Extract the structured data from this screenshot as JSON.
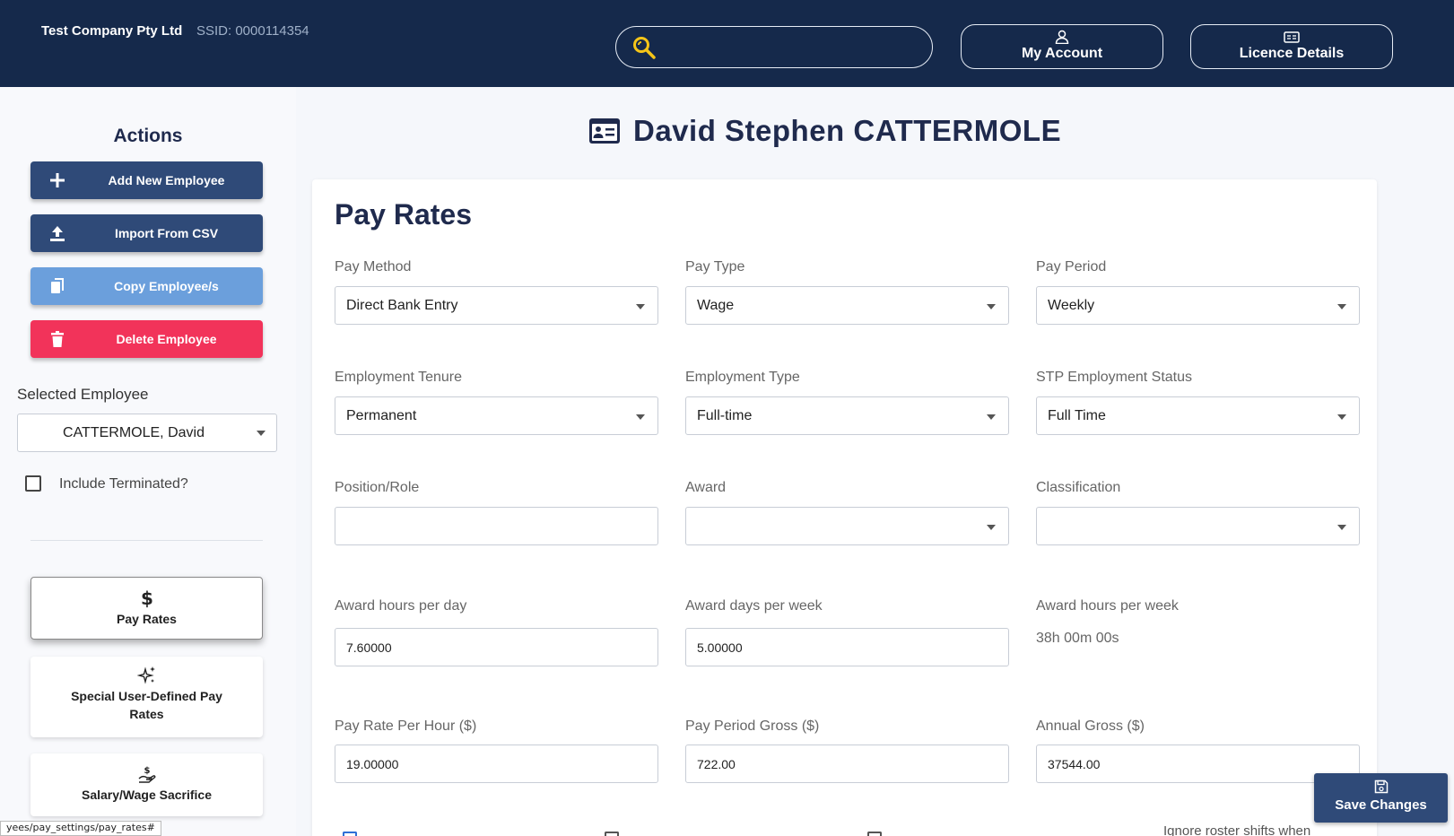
{
  "header": {
    "company": "Test Company Pty Ltd",
    "ssid": "SSID: 0000114354",
    "search": {
      "placeholder": ""
    },
    "my_account": "My Account",
    "licence_details": "Licence Details"
  },
  "sidebar": {
    "actions_title": "Actions",
    "buttons": {
      "add": "Add New Employee",
      "import": "Import From CSV",
      "copy": "Copy Employee/s",
      "delete": "Delete Employee"
    },
    "selected_employee_label": "Selected Employee",
    "selected_employee": "CATTERMOLE, David",
    "include_terminated": "Include Terminated?",
    "include_terminated_checked": false,
    "nav": {
      "pay_rates": "Pay Rates",
      "special": "Special User-Defined Pay Rates",
      "salary": "Salary/Wage Sacrifice"
    },
    "status_url": "yees/pay_settings/pay_rates#"
  },
  "main": {
    "employee_name": "David Stephen CATTERMOLE",
    "section_title": "Pay Rates",
    "fields": {
      "pay_method": {
        "label": "Pay Method",
        "value": "Direct Bank Entry"
      },
      "pay_type": {
        "label": "Pay Type",
        "value": "Wage"
      },
      "pay_period": {
        "label": "Pay Period",
        "value": "Weekly"
      },
      "employment_tenure": {
        "label": "Employment Tenure",
        "value": "Permanent"
      },
      "employment_type": {
        "label": "Employment Type",
        "value": "Full-time"
      },
      "stp_status": {
        "label": "STP Employment Status",
        "value": "Full Time"
      },
      "position_role": {
        "label": "Position/Role",
        "value": ""
      },
      "award": {
        "label": "Award",
        "value": ""
      },
      "classification": {
        "label": "Classification",
        "value": ""
      },
      "award_hours_day": {
        "label": "Award hours per day",
        "value": "7.60000"
      },
      "award_days_week": {
        "label": "Award days per week",
        "value": "5.00000"
      },
      "award_hours_week": {
        "label": "Award hours per week",
        "value": "38h 00m 00s"
      },
      "pay_rate_hour": {
        "label": "Pay Rate Per Hour ($)",
        "value": "19.00000"
      },
      "pay_period_gross": {
        "label": "Pay Period Gross ($)",
        "value": "722.00"
      },
      "annual_gross": {
        "label": "Annual Gross ($)",
        "value": "37544.00"
      }
    },
    "cut_text": "Ignore roster shifts when",
    "save_changes": "Save Changes"
  },
  "colors": {
    "header_bg": "#15294b",
    "primary_button": "#2f4a78",
    "copy_button": "#6b9fdc",
    "delete_button": "#f2335a",
    "search_icon": "#f5c518"
  }
}
